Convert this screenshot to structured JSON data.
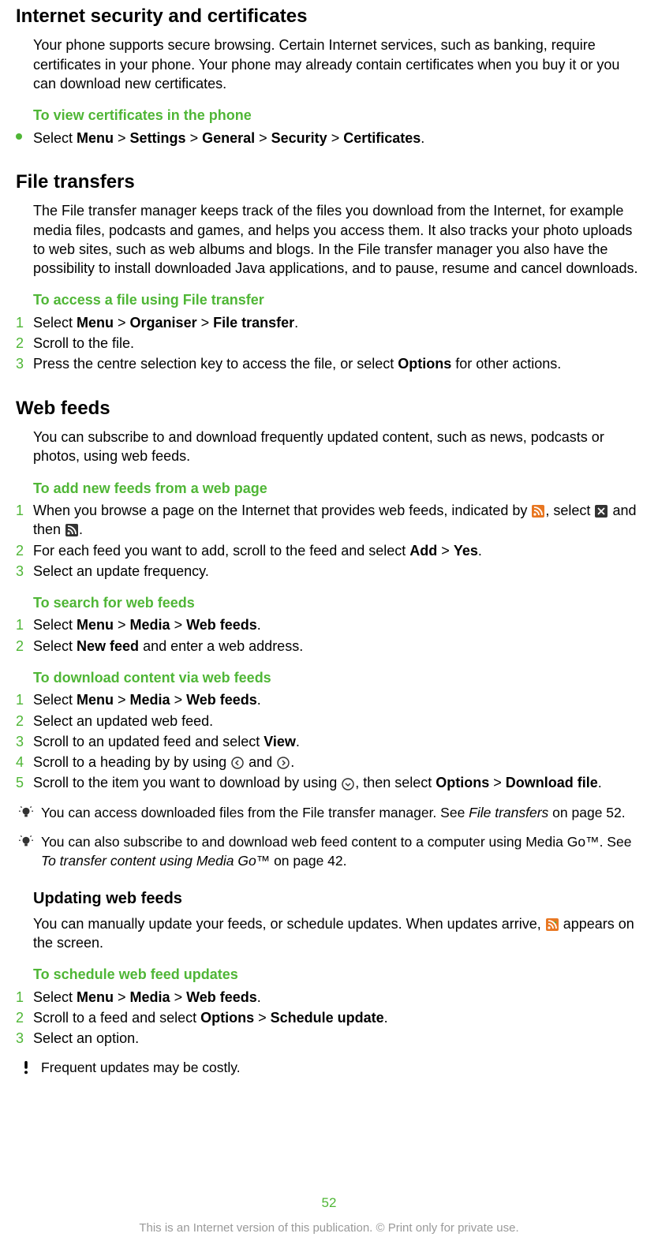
{
  "s1": {
    "title": "Internet security and certificates",
    "body": "Your phone supports secure browsing. Certain Internet services, such as banking, require certificates in your phone. Your phone may already contain certificates when you buy it or you can download new certificates.",
    "sub1": {
      "title": "To view certificates in the phone",
      "steps": [
        {
          "pre": "Select ",
          "path": [
            "Menu",
            "Settings",
            "General",
            "Security",
            "Certificates"
          ],
          "post": "."
        }
      ]
    }
  },
  "s2": {
    "title": "File transfers",
    "body": "The File transfer manager keeps track of the files you download from the Internet, for example media files, podcasts and games, and helps you access them. It also tracks your photo uploads to web sites, such as web albums and blogs. In the File transfer manager you also have the possibility to install downloaded Java applications, and to pause, resume and cancel downloads.",
    "sub1": {
      "title": "To access a file using File transfer",
      "steps": [
        {
          "n": "1",
          "pre": "Select ",
          "path": [
            "Menu",
            "Organiser",
            "File transfer"
          ],
          "post": "."
        },
        {
          "n": "2",
          "text": "Scroll to the file."
        },
        {
          "n": "3",
          "pre": "Press the centre selection key to access the file, or select ",
          "bold": "Options",
          "post": " for other actions."
        }
      ]
    }
  },
  "s3": {
    "title": "Web feeds",
    "body": "You can subscribe to and download frequently updated content, such as news, podcasts or photos, using web feeds.",
    "sub1": {
      "title": "To add new feeds from a web page",
      "steps": [
        {
          "n": "1",
          "frag1": "When you browse a page on the Internet that provides web feeds, indicated by ",
          "frag2": ", select ",
          "frag3": " and then ",
          "frag4": "."
        },
        {
          "n": "2",
          "pre": "For each feed you want to add, scroll to the feed and select ",
          "path": [
            "Add",
            "Yes"
          ],
          "post": "."
        },
        {
          "n": "3",
          "text": "Select an update frequency."
        }
      ]
    },
    "sub2": {
      "title": "To search for web feeds",
      "steps": [
        {
          "n": "1",
          "pre": "Select ",
          "path": [
            "Menu",
            "Media",
            "Web feeds"
          ],
          "post": "."
        },
        {
          "n": "2",
          "pre": "Select ",
          "bold": "New feed",
          "post": " and enter a web address."
        }
      ]
    },
    "sub3": {
      "title": "To download content via web feeds",
      "steps": [
        {
          "n": "1",
          "pre": "Select ",
          "path": [
            "Menu",
            "Media",
            "Web feeds"
          ],
          "post": "."
        },
        {
          "n": "2",
          "text": "Select an updated web feed."
        },
        {
          "n": "3",
          "pre": "Scroll to an updated feed and select ",
          "bold": "View",
          "post": "."
        },
        {
          "n": "4",
          "frag1": "Scroll to a heading by by using ",
          "frag2": " and ",
          "frag3": "."
        },
        {
          "n": "5",
          "frag1": "Scroll to the item you want to download by using ",
          "frag2": ", then select ",
          "path": [
            "Options",
            "Download file"
          ],
          "post": "."
        }
      ]
    },
    "tip1": {
      "pre": "You can access downloaded files from the File transfer manager. See ",
      "italic": "File transfers",
      "post": " on page 52."
    },
    "tip2": {
      "pre": "You can also subscribe to and download web feed content to a computer using Media Go™. See ",
      "italic": "To transfer content using Media Go™",
      "post": " on page 42."
    }
  },
  "s4": {
    "title": "Updating web feeds",
    "body_pre": "You can manually update your feeds, or schedule updates. When updates arrive, ",
    "body_post": " appears on the screen.",
    "sub1": {
      "title": "To schedule web feed updates",
      "steps": [
        {
          "n": "1",
          "pre": "Select ",
          "path": [
            "Menu",
            "Media",
            "Web feeds"
          ],
          "post": "."
        },
        {
          "n": "2",
          "pre": "Scroll to a feed and select ",
          "path": [
            "Options",
            "Schedule update"
          ],
          "post": "."
        },
        {
          "n": "3",
          "text": "Select an option."
        }
      ]
    },
    "warn": "Frequent updates may be costly."
  },
  "footer": {
    "page": "52",
    "text": "This is an Internet version of this publication. © Print only for private use."
  }
}
